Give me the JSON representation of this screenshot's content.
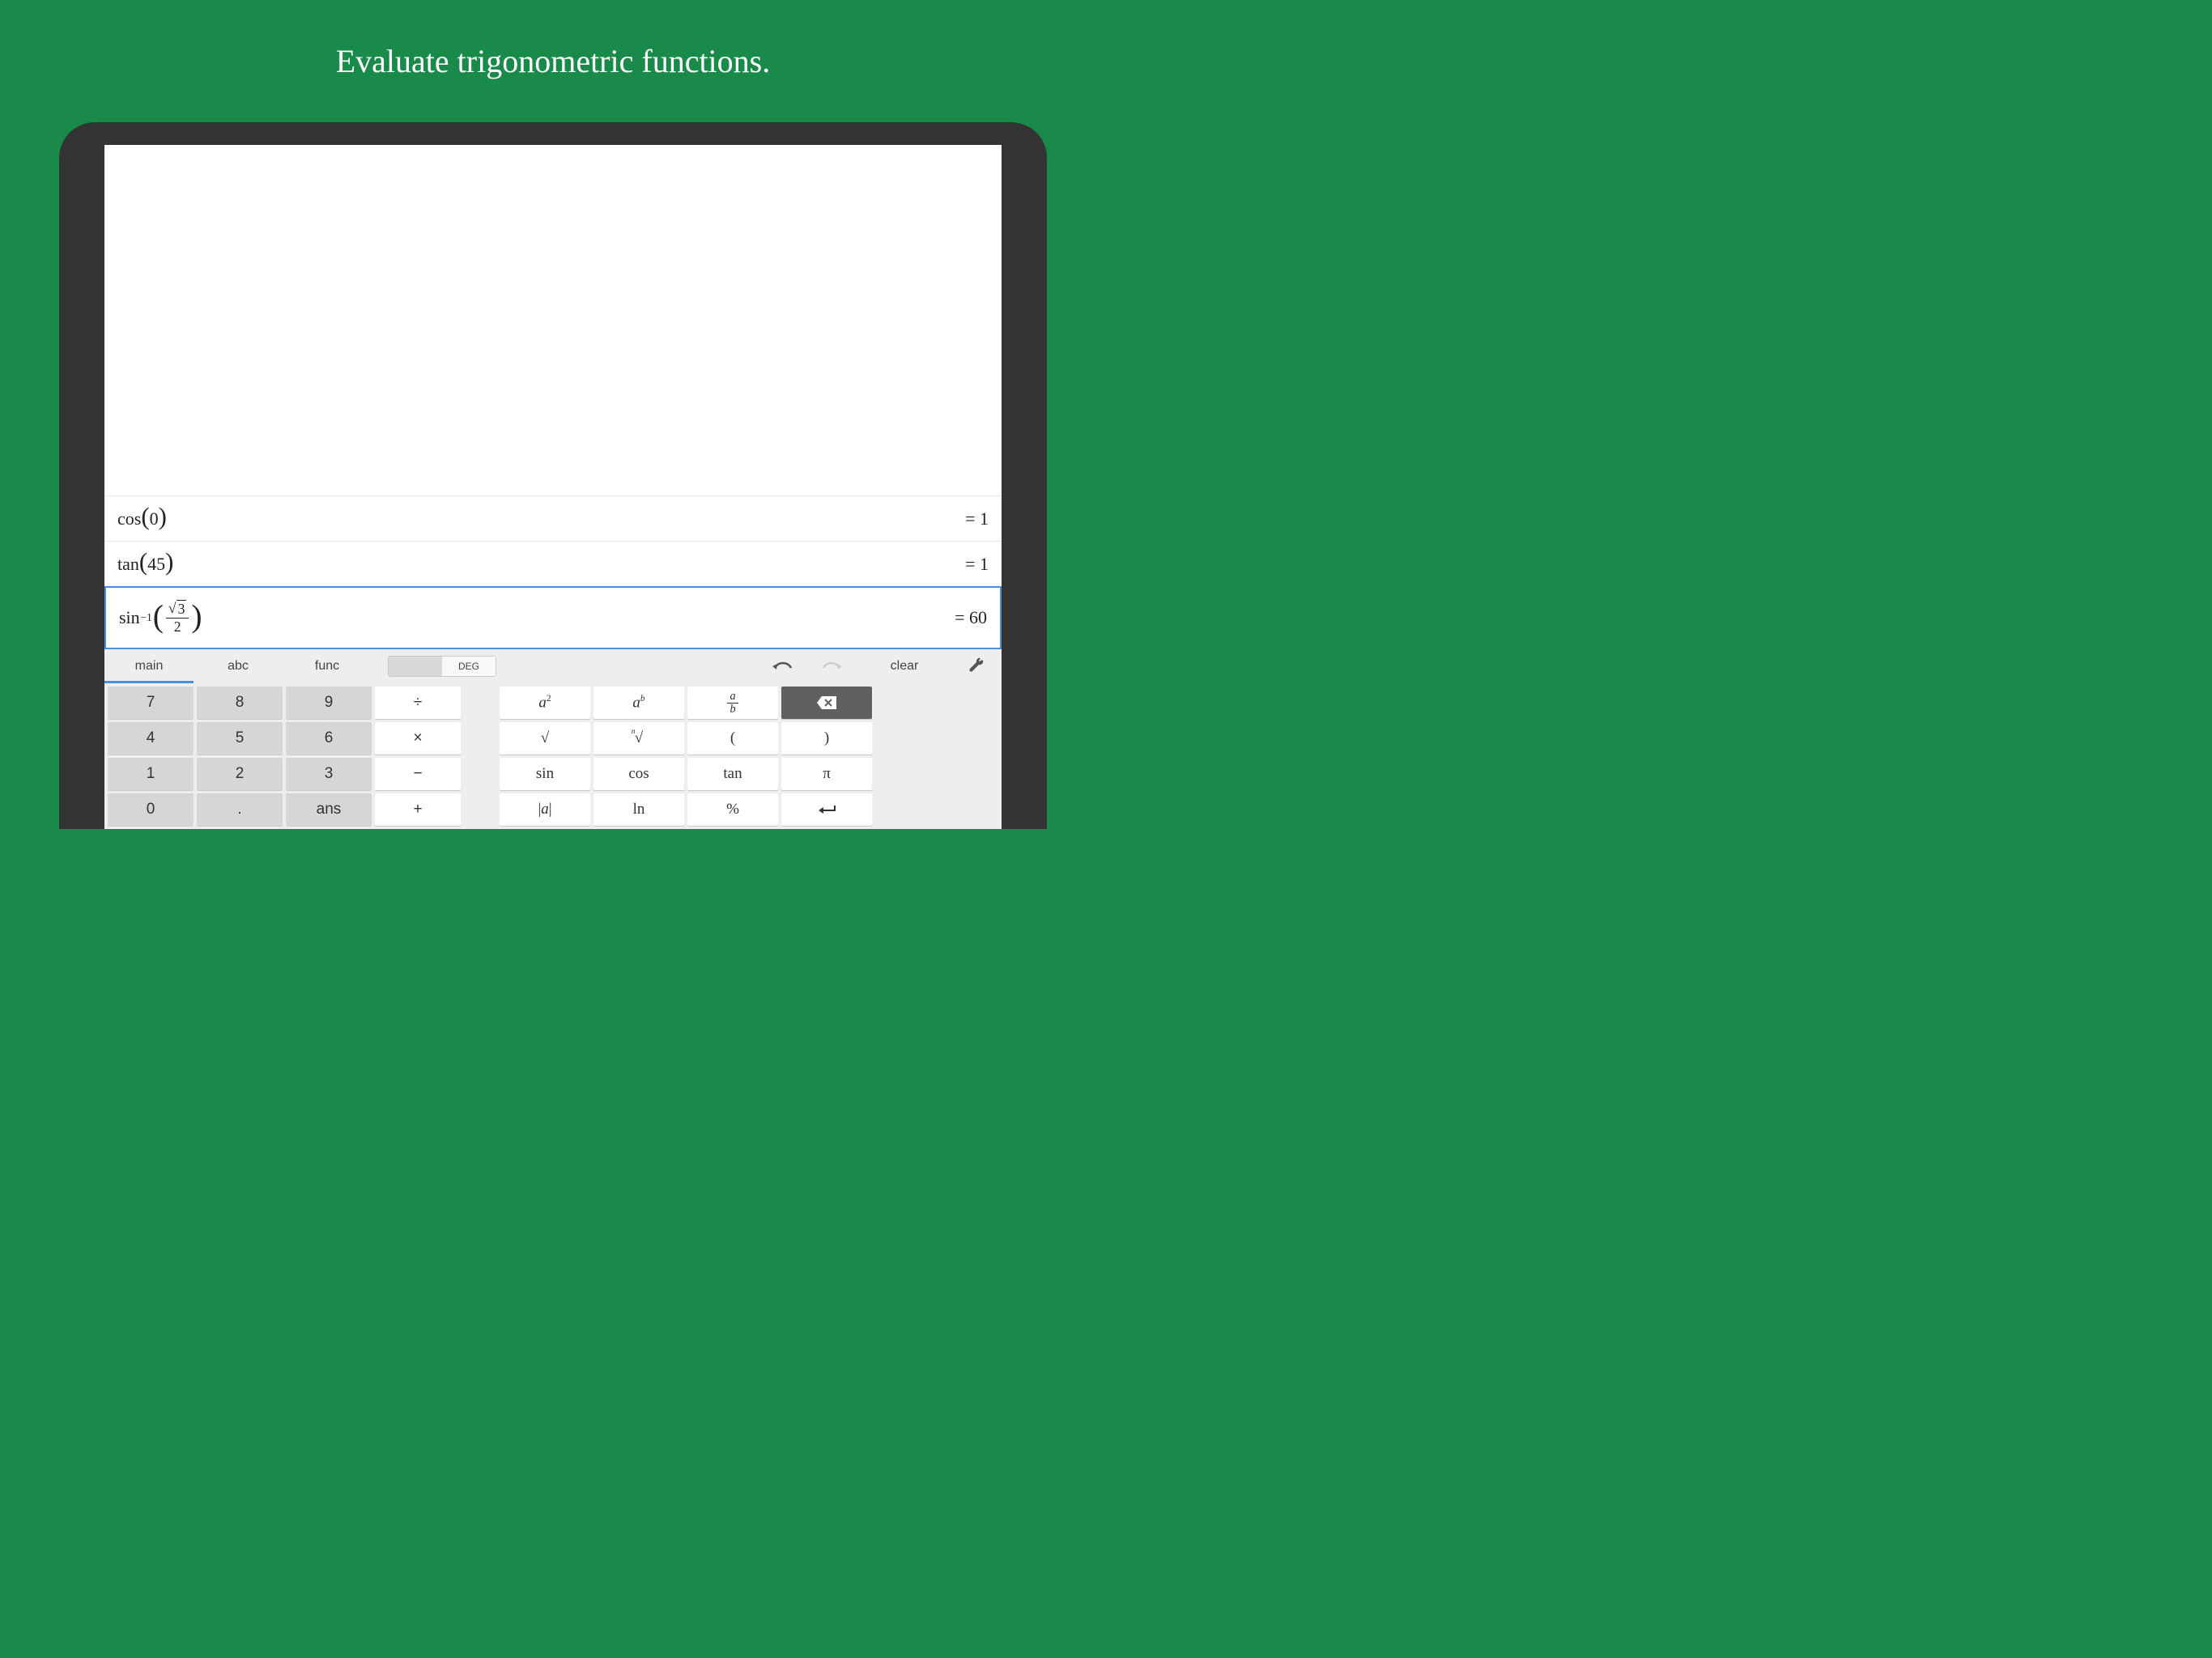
{
  "heading": "Evaluate trigonometric functions.",
  "history": [
    {
      "expr_fn": "cos",
      "expr_inner": "0",
      "result": "= 1"
    },
    {
      "expr_fn": "tan",
      "expr_inner": "45",
      "result": "= 1"
    }
  ],
  "active": {
    "fn": "sin",
    "sup": "−1",
    "frac_num_sqrt": "3",
    "frac_den": "2",
    "result": "= 60"
  },
  "toolbar": {
    "tabs": [
      "main",
      "abc",
      "func"
    ],
    "active_tab": 0,
    "mode_label": "DEG",
    "clear": "clear"
  },
  "keypad": {
    "nums": [
      [
        "7",
        "8",
        "9"
      ],
      [
        "4",
        "5",
        "6"
      ],
      [
        "1",
        "2",
        "3"
      ],
      [
        "0",
        ".",
        "ans"
      ]
    ],
    "ops": [
      "÷",
      "×",
      "−",
      "+"
    ],
    "fns": [
      [
        "a²",
        "aᵇ",
        "a/b",
        "⌫"
      ],
      [
        "√",
        "ⁿ√",
        "(",
        ")"
      ],
      [
        "sin",
        "cos",
        "tan",
        "π"
      ],
      [
        "|a|",
        "ln",
        "%",
        "↵"
      ]
    ]
  }
}
